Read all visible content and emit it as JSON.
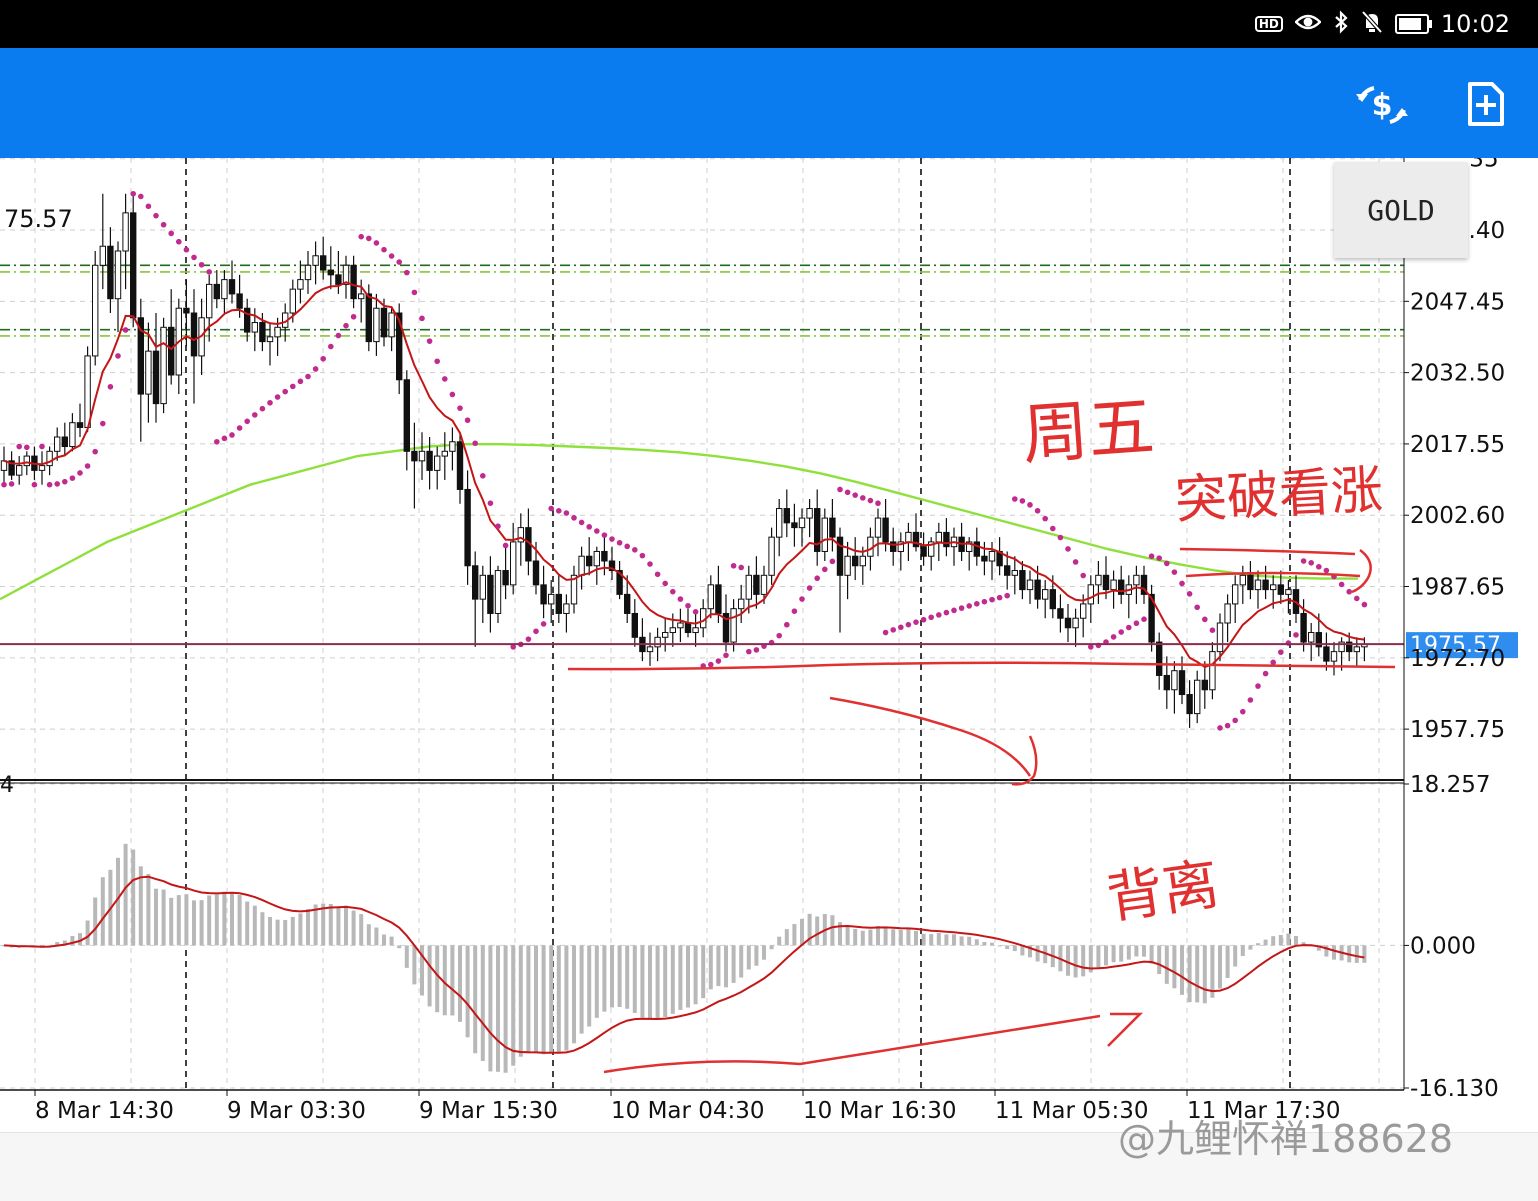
{
  "status_bar": {
    "time": "10:02",
    "hd_label": "HD",
    "battery_level": 0.75,
    "icons": [
      "hd-icon",
      "eye-icon",
      "bluetooth-icon",
      "bell-muted-icon",
      "battery-icon"
    ]
  },
  "toolbar": {
    "background": "#0b7cf0",
    "icons": [
      "quotes-icon",
      "new-order-icon"
    ]
  },
  "symbol": "GOLD",
  "watermark": "@九鲤怀禅188628",
  "chart_data": {
    "type": "candlestick",
    "timeframe": "H1",
    "price_axis_labels": [
      "2062.40",
      "2047.45",
      "2032.50",
      "2017.55",
      "2002.60",
      "1987.65",
      "1972.70",
      "1957.75"
    ],
    "price_axis_top_partial": ".35",
    "price_range": [
      1947.5,
      2077.5
    ],
    "current_price": "1975.57",
    "current_price_partial_left": "75.57",
    "time_axis_labels": [
      "8 Mar 14:30",
      "9 Mar 03:30",
      "9 Mar 15:30",
      "10 Mar 04:30",
      "10 Mar 16:30",
      "11 Mar 05:30",
      "11 Mar 17:30"
    ],
    "period_separators": [
      "9 Mar",
      "10 Mar",
      "11 Mar",
      "12 Mar"
    ],
    "resistance_levels": [
      2055.0,
      2053.6,
      2041.5,
      2040.2
    ],
    "candles": [
      [
        2012,
        2017,
        2009,
        2014
      ],
      [
        2014,
        2016,
        2010,
        2011
      ],
      [
        2011,
        2015,
        2009,
        2013
      ],
      [
        2013,
        2016,
        2011,
        2015
      ],
      [
        2015,
        2017,
        2010,
        2012
      ],
      [
        2012,
        2016,
        2009,
        2013
      ],
      [
        2013,
        2017,
        2011,
        2016
      ],
      [
        2016,
        2021,
        2014,
        2019
      ],
      [
        2019,
        2022,
        2015,
        2017
      ],
      [
        2017,
        2024,
        2016,
        2022
      ],
      [
        2022,
        2026,
        2019,
        2021
      ],
      [
        2021,
        2038,
        2020,
        2036
      ],
      [
        2036,
        2058,
        2034,
        2055
      ],
      [
        2055,
        2070,
        2050,
        2059
      ],
      [
        2059,
        2063,
        2045,
        2048
      ],
      [
        2048,
        2060,
        2041,
        2058
      ],
      [
        2058,
        2070,
        2050,
        2066
      ],
      [
        2066,
        2070,
        2042,
        2044
      ],
      [
        2044,
        2048,
        2018,
        2028
      ],
      [
        2028,
        2043,
        2022,
        2037
      ],
      [
        2037,
        2045,
        2022,
        2026
      ],
      [
        2026,
        2044,
        2024,
        2042
      ],
      [
        2042,
        2050,
        2030,
        2032
      ],
      [
        2032,
        2048,
        2028,
        2046
      ],
      [
        2046,
        2052,
        2038,
        2045
      ],
      [
        2045,
        2050,
        2026,
        2036
      ],
      [
        2036,
        2048,
        2032,
        2044
      ],
      [
        2044,
        2053,
        2039,
        2051
      ],
      [
        2051,
        2054,
        2046,
        2048
      ],
      [
        2048,
        2054,
        2045,
        2052
      ],
      [
        2052,
        2056,
        2047,
        2049
      ],
      [
        2049,
        2053,
        2044,
        2046
      ],
      [
        2046,
        2048,
        2039,
        2041
      ],
      [
        2041,
        2046,
        2037,
        2043
      ],
      [
        2043,
        2045,
        2037,
        2039
      ],
      [
        2039,
        2043,
        2034,
        2040
      ],
      [
        2040,
        2044,
        2036,
        2042
      ],
      [
        2042,
        2047,
        2039,
        2045
      ],
      [
        2045,
        2052,
        2043,
        2050
      ],
      [
        2050,
        2056,
        2047,
        2052
      ],
      [
        2052,
        2058,
        2049,
        2055
      ],
      [
        2055,
        2060,
        2051,
        2057
      ],
      [
        2057,
        2061,
        2052,
        2054
      ],
      [
        2054,
        2059,
        2050,
        2053
      ],
      [
        2053,
        2058,
        2049,
        2051
      ],
      [
        2051,
        2057,
        2048,
        2055
      ],
      [
        2055,
        2057,
        2046,
        2048
      ],
      [
        2048,
        2052,
        2043,
        2049
      ],
      [
        2049,
        2051,
        2037,
        2039
      ],
      [
        2039,
        2049,
        2036,
        2046
      ],
      [
        2046,
        2048,
        2038,
        2040
      ],
      [
        2040,
        2046,
        2037,
        2045
      ],
      [
        2045,
        2047,
        2028,
        2031
      ],
      [
        2031,
        2033,
        2012,
        2016
      ],
      [
        2016,
        2022,
        2004,
        2014
      ],
      [
        2014,
        2020,
        2010,
        2016
      ],
      [
        2016,
        2019,
        2008,
        2012
      ],
      [
        2012,
        2017,
        2008,
        2015
      ],
      [
        2015,
        2020,
        2010,
        2016
      ],
      [
        2016,
        2021,
        2012,
        2018
      ],
      [
        2018,
        2020,
        2005,
        2008
      ],
      [
        2008,
        2012,
        1988,
        1992
      ],
      [
        1992,
        1995,
        1975,
        1985
      ],
      [
        1985,
        1992,
        1980,
        1990
      ],
      [
        1990,
        1994,
        1978,
        1982
      ],
      [
        1982,
        1992,
        1980,
        1991
      ],
      [
        1991,
        1996,
        1985,
        1988
      ],
      [
        1988,
        2001,
        1986,
        1997
      ],
      [
        1997,
        2003,
        1992,
        2000
      ],
      [
        2000,
        2004,
        1990,
        1993
      ],
      [
        1993,
        1997,
        1986,
        1988
      ],
      [
        1988,
        1992,
        1981,
        1984
      ],
      [
        1984,
        1989,
        1980,
        1986
      ],
      [
        1986,
        1990,
        1980,
        1982
      ],
      [
        1982,
        1986,
        1978,
        1984
      ],
      [
        1984,
        1992,
        1982,
        1990
      ],
      [
        1990,
        1996,
        1987,
        1994
      ],
      [
        1994,
        1998,
        1990,
        1992
      ],
      [
        1992,
        1996,
        1988,
        1995
      ],
      [
        1995,
        1998,
        1990,
        1993
      ],
      [
        1993,
        1996,
        1989,
        1991
      ],
      [
        1991,
        1993,
        1985,
        1986
      ],
      [
        1986,
        1990,
        1980,
        1982
      ],
      [
        1982,
        1985,
        1975,
        1977
      ],
      [
        1977,
        1981,
        1972,
        1974
      ],
      [
        1974,
        1978,
        1971,
        1975
      ],
      [
        1975,
        1979,
        1972,
        1977
      ],
      [
        1977,
        1981,
        1974,
        1978
      ],
      [
        1978,
        1982,
        1975,
        1979
      ],
      [
        1979,
        1983,
        1976,
        1980
      ],
      [
        1980,
        1983,
        1977,
        1978
      ],
      [
        1978,
        1982,
        1975,
        1979
      ],
      [
        1979,
        1985,
        1977,
        1983
      ],
      [
        1983,
        1990,
        1981,
        1988
      ],
      [
        1988,
        1992,
        1980,
        1982
      ],
      [
        1982,
        1986,
        1974,
        1976
      ],
      [
        1976,
        1985,
        1974,
        1983
      ],
      [
        1983,
        1988,
        1980,
        1985
      ],
      [
        1985,
        1992,
        1982,
        1990
      ],
      [
        1990,
        1994,
        1983,
        1986
      ],
      [
        1986,
        1992,
        1984,
        1990
      ],
      [
        1990,
        2000,
        1988,
        1998
      ],
      [
        1998,
        2006,
        1994,
        2004
      ],
      [
        2004,
        2008,
        1998,
        2001
      ],
      [
        2001,
        2005,
        1996,
        2000
      ],
      [
        2000,
        2004,
        1996,
        2002
      ],
      [
        2002,
        2006,
        1998,
        2004
      ],
      [
        2004,
        2008,
        1992,
        1995
      ],
      [
        1995,
        2004,
        1993,
        2002
      ],
      [
        2002,
        2006,
        1995,
        1998
      ],
      [
        1998,
        2000,
        1978,
        1990
      ],
      [
        1990,
        1997,
        1985,
        1994
      ],
      [
        1994,
        1998,
        1989,
        1992
      ],
      [
        1992,
        1996,
        1988,
        1994
      ],
      [
        1994,
        2000,
        1991,
        1998
      ],
      [
        1998,
        2004,
        1994,
        2002
      ],
      [
        2002,
        2006,
        1995,
        1997
      ],
      [
        1997,
        2000,
        1992,
        1995
      ],
      [
        1995,
        1999,
        1991,
        1997
      ],
      [
        1997,
        2001,
        1993,
        1999
      ],
      [
        1999,
        2003,
        1995,
        1996
      ],
      [
        1996,
        1999,
        1992,
        1994
      ],
      [
        1994,
        1998,
        1991,
        1997
      ],
      [
        1997,
        2001,
        1993,
        1999
      ],
      [
        1999,
        2002,
        1994,
        1996
      ],
      [
        1996,
        2000,
        1992,
        1998
      ],
      [
        1998,
        2001,
        1993,
        1995
      ],
      [
        1995,
        1998,
        1991,
        1997
      ],
      [
        1997,
        2000,
        1992,
        1994
      ],
      [
        1994,
        1997,
        1990,
        1993
      ],
      [
        1993,
        1997,
        1989,
        1995
      ],
      [
        1995,
        1998,
        1990,
        1992
      ],
      [
        1992,
        1995,
        1987,
        1990
      ],
      [
        1990,
        1994,
        1986,
        1991
      ],
      [
        1991,
        1993,
        1985,
        1987
      ],
      [
        1987,
        1991,
        1984,
        1989
      ],
      [
        1989,
        1992,
        1983,
        1985
      ],
      [
        1985,
        1989,
        1981,
        1987
      ],
      [
        1987,
        1990,
        1981,
        1983
      ],
      [
        1983,
        1986,
        1978,
        1981
      ],
      [
        1981,
        1984,
        1976,
        1979
      ],
      [
        1979,
        1983,
        1975,
        1981
      ],
      [
        1981,
        1986,
        1977,
        1984
      ],
      [
        1984,
        1990,
        1980,
        1988
      ],
      [
        1988,
        1993,
        1984,
        1990
      ],
      [
        1990,
        1994,
        1985,
        1987
      ],
      [
        1987,
        1991,
        1983,
        1989
      ],
      [
        1989,
        1992,
        1984,
        1986
      ],
      [
        1986,
        1990,
        1981,
        1988
      ],
      [
        1988,
        1992,
        1984,
        1990
      ],
      [
        1990,
        1992,
        1984,
        1986
      ],
      [
        1986,
        1988,
        1974,
        1976
      ],
      [
        1976,
        1978,
        1966,
        1969
      ],
      [
        1969,
        1973,
        1962,
        1966
      ],
      [
        1966,
        1972,
        1961,
        1970
      ],
      [
        1970,
        1973,
        1963,
        1965
      ],
      [
        1965,
        1968,
        1958,
        1961
      ],
      [
        1961,
        1970,
        1959,
        1968
      ],
      [
        1968,
        1972,
        1962,
        1966
      ],
      [
        1966,
        1976,
        1964,
        1974
      ],
      [
        1974,
        1982,
        1972,
        1980
      ],
      [
        1980,
        1986,
        1976,
        1984
      ],
      [
        1984,
        1990,
        1980,
        1988
      ],
      [
        1988,
        1992,
        1984,
        1990
      ],
      [
        1990,
        1993,
        1985,
        1987
      ],
      [
        1987,
        1991,
        1983,
        1989
      ],
      [
        1989,
        1992,
        1985,
        1987
      ],
      [
        1987,
        1990,
        1983,
        1988
      ],
      [
        1988,
        1991,
        1984,
        1986
      ],
      [
        1986,
        1989,
        1982,
        1987
      ],
      [
        1987,
        1990,
        1980,
        1982
      ],
      [
        1982,
        1985,
        1974,
        1976
      ],
      [
        1976,
        1980,
        1972,
        1978
      ],
      [
        1978,
        1982,
        1973,
        1975
      ],
      [
        1975,
        1978,
        1970,
        1972
      ],
      [
        1972,
        1976,
        1969,
        1974
      ],
      [
        1974,
        1977,
        1970,
        1976
      ],
      [
        1976,
        1978,
        1972,
        1974
      ],
      [
        1974,
        1977,
        1971,
        1975
      ],
      [
        1975,
        1977,
        1972,
        1975.57
      ]
    ],
    "ma_fast": {
      "color": "#c41616"
    },
    "ma_slow": {
      "color": "#8ee03a",
      "values": [
        1985,
        1989,
        1993,
        1997,
        2000,
        2003,
        2006,
        2009,
        2011,
        2013,
        2015,
        2016,
        2017,
        2017.5,
        2017.5,
        2017.3,
        2017,
        2016.7,
        2016.3,
        2015.8,
        2015,
        2014,
        2012.8,
        2011.3,
        2009.5,
        2007.5,
        2005.5,
        2003.5,
        2001.5,
        1999.5,
        1997.5,
        1995.5,
        1993.8,
        1992.3,
        1991,
        1990,
        1989.5,
        1989.3,
        1989.3
      ]
    },
    "parabolic_sar": {
      "color": "#c02b8d"
    },
    "macd": {
      "axis_labels": [
        "18.257",
        "0.000",
        "-16.130"
      ],
      "range": [
        -16.13,
        18.257
      ],
      "histogram_color": "#b8b8b8",
      "signal_color": "#c41616",
      "partial_left_label": "4"
    },
    "annotations": [
      "hand-drawn arrow down-right",
      "hand-drawn arrow right (price)",
      "hand-drawn arrow right (MACD)",
      "hand-drawn support line",
      "handwritten note 周五",
      "handwritten note 突破看涨",
      "handwritten note 背离"
    ]
  }
}
